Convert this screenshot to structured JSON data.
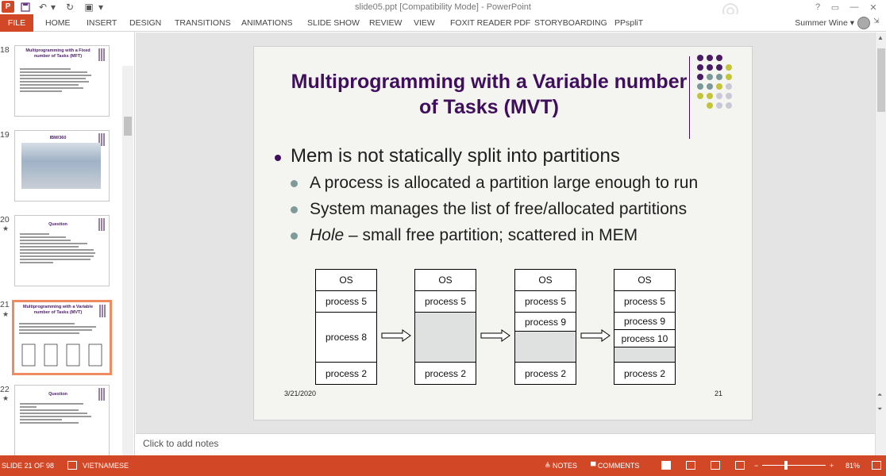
{
  "app": {
    "document_title": "slide05.ppt [Compatibility Mode] - PowerPoint",
    "help": "?",
    "user_name": "Summer Wine"
  },
  "ribbon": {
    "tabs": [
      "FILE",
      "HOME",
      "INSERT",
      "DESIGN",
      "TRANSITIONS",
      "ANIMATIONS",
      "SLIDE SHOW",
      "REVIEW",
      "VIEW",
      "FOXIT READER PDF",
      "STORYBOARDING",
      "PPspliT"
    ]
  },
  "thumbnails": [
    {
      "num": "18",
      "title": "Multiprogramming with a Fixed number of Tasks (MFT)",
      "starred": false
    },
    {
      "num": "19",
      "title": "IBM/360",
      "starred": false
    },
    {
      "num": "20",
      "title": "Question",
      "starred": true
    },
    {
      "num": "21",
      "title": "Multiprogramming with a Variable number of Tasks (MVT)",
      "starred": true,
      "selected": true
    },
    {
      "num": "22",
      "title": "Question",
      "starred": true
    }
  ],
  "slide": {
    "title": "Multiprogramming with a Variable number of Tasks (MVT)",
    "bullet": "Mem is not statically split into partitions",
    "sub_bullets": [
      "A process is allocated a partition large enough to run",
      "System manages the list of free/allocated partitions"
    ],
    "hole_term": "Hole",
    "hole_rest": " – small free partition; scattered in MEM",
    "memory_columns": [
      [
        "OS",
        "process 5",
        "process 8",
        "process 2"
      ],
      [
        "OS",
        "process 5",
        "",
        "process 2"
      ],
      [
        "OS",
        "process 5",
        "process 9",
        "",
        "process 2"
      ],
      [
        "OS",
        "process 5",
        "process 9",
        "process 10",
        "",
        "process 2"
      ]
    ],
    "date": "3/21/2020",
    "number": "21",
    "dot_colors": [
      "#4a1c63",
      "#7b9898",
      "#c4c43a",
      "#c9c9d6"
    ]
  },
  "notes_placeholder": "Click to add notes",
  "status": {
    "slide_info": "SLIDE 21 OF 98",
    "language": "VIETNAMESE",
    "notes_label": "NOTES",
    "comments_label": "COMMENTS",
    "zoom": "81%"
  }
}
